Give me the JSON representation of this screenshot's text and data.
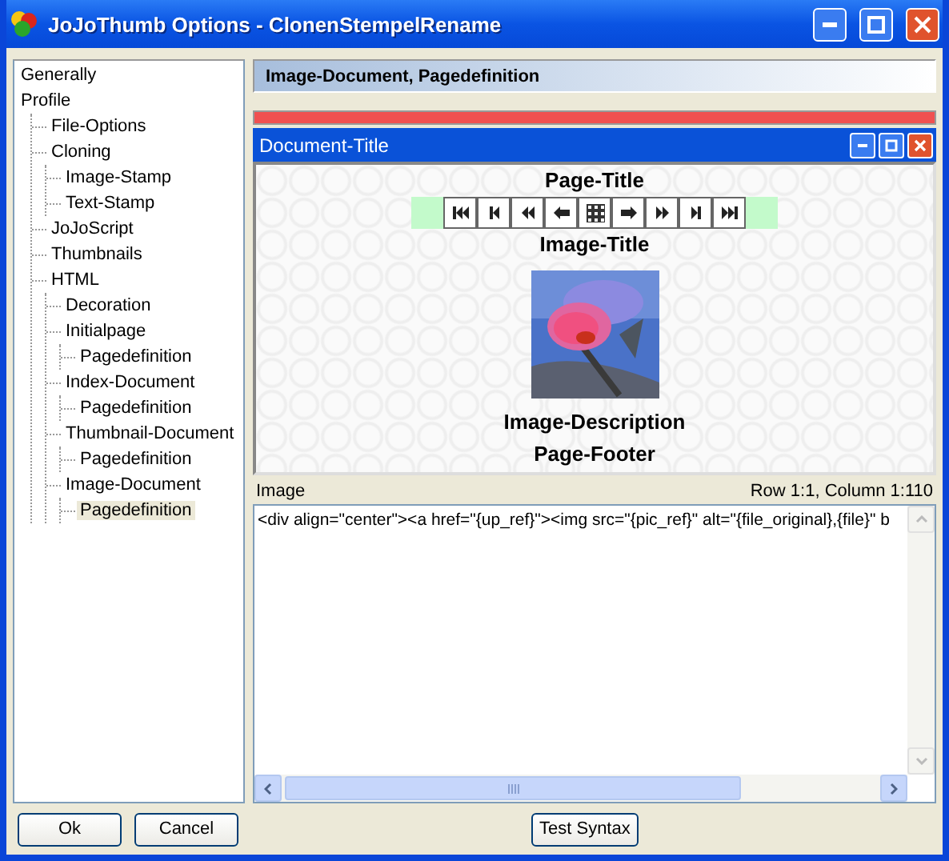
{
  "window": {
    "title": "JoJoThumb Options - ClonenStempelRename"
  },
  "tree": [
    {
      "label": "Generally",
      "selected": false
    },
    {
      "label": "Profile",
      "selected": false,
      "children": [
        {
          "label": "File-Options",
          "selected": false
        },
        {
          "label": "Cloning",
          "selected": false,
          "children": [
            {
              "label": "Image-Stamp",
              "selected": false
            },
            {
              "label": "Text-Stamp",
              "selected": false
            }
          ]
        },
        {
          "label": "JoJoScript",
          "selected": false
        },
        {
          "label": "Thumbnails",
          "selected": false
        },
        {
          "label": "HTML",
          "selected": false,
          "children": [
            {
              "label": "Decoration",
              "selected": false
            },
            {
              "label": "Initialpage",
              "selected": false,
              "children": [
                {
                  "label": "Pagedefinition",
                  "selected": false
                }
              ]
            },
            {
              "label": "Index-Document",
              "selected": false,
              "children": [
                {
                  "label": "Pagedefinition",
                  "selected": false
                }
              ]
            },
            {
              "label": "Thumbnail-Document",
              "selected": false,
              "children": [
                {
                  "label": "Pagedefinition",
                  "selected": false
                }
              ]
            },
            {
              "label": "Image-Document",
              "selected": false,
              "children": [
                {
                  "label": "Pagedefinition",
                  "selected": true
                }
              ]
            }
          ]
        }
      ]
    }
  ],
  "header": "Image-Document, Pagedefinition",
  "preview": {
    "window_title": "Document-Title",
    "page_title": "Page-Title",
    "image_title": "Image-Title",
    "image_description": "Image-Description",
    "page_footer": "Page-Footer"
  },
  "editor": {
    "label": "Image",
    "position": "Row 1:1, Column 1:110",
    "code": "<div align=\"center\"><a href=\"{up_ref}\"><img src=\"{pic_ref}\" alt=\"{file_original},{file}\" b"
  },
  "buttons": {
    "ok": "Ok",
    "cancel": "Cancel",
    "test": "Test Syntax"
  }
}
